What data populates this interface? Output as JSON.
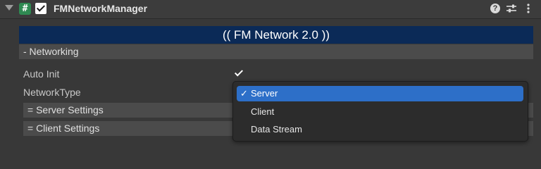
{
  "component": {
    "title": "FMNetworkManager",
    "script_icon_glyph": "#",
    "enabled": true,
    "icons": [
      "foldout-arrow-icon",
      "script-icon",
      "help-icon",
      "preset-icon",
      "menu-icon"
    ]
  },
  "banner": {
    "text": "(( FM Network 2.0 ))"
  },
  "networking_header": {
    "text": "- Networking"
  },
  "fields": {
    "auto_init_label": "Auto Init",
    "auto_init_checked": true,
    "network_type_label": "NetworkType"
  },
  "sections": {
    "server_settings": "= Server Settings",
    "client_settings": "= Client Settings"
  },
  "dropdown": {
    "selected_mark": "✓",
    "options": [
      {
        "label": "Server",
        "selected": true
      },
      {
        "label": "Client",
        "selected": false
      },
      {
        "label": "Data Stream",
        "selected": false
      }
    ]
  },
  "colors": {
    "background": "#383838",
    "banner": "#0b2a57",
    "selection": "#2d6fc8",
    "script_icon": "#2f8a52"
  }
}
